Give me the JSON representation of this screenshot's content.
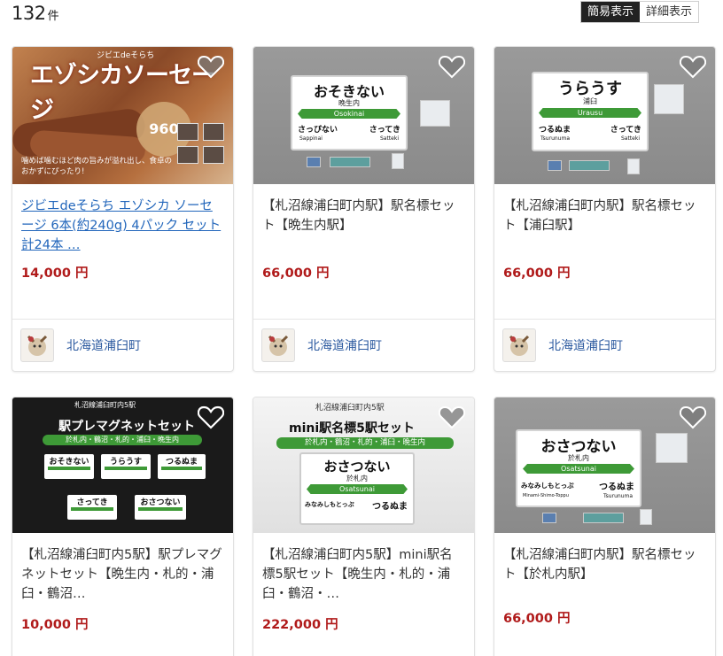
{
  "result": {
    "count": "132",
    "unit": "件"
  },
  "view_toggle": {
    "simple": "簡易表示",
    "detail": "詳細表示"
  },
  "colors": {
    "price": "#b01a1a",
    "link": "#2266bb",
    "seller": "#2c5aa0",
    "board_green": "#3e9a37"
  },
  "products": [
    {
      "title": "ジビエdeそらち エゾシカ ソーセージ 6本(約240g) 4パック セット 計24本 …",
      "price": "14,000 円",
      "seller": "北海道浦臼町",
      "image": {
        "headline": "エゾシカソーセージ",
        "brand": "ジビエdeそらち",
        "badge": "960",
        "caption": "噛めば噛むほど肉の旨みが溢れ出し、食卓のおかずにぴったり!"
      }
    },
    {
      "title": "【札沼線浦臼町内駅】駅名標セット【晩生内駅】",
      "price": "66,000 円",
      "seller": "北海道浦臼町",
      "image": {
        "kana": "おそきない",
        "kanji": "晩生内",
        "romaji": "Osokinai",
        "left": "さっぴない",
        "left_romaji": "Sappinai",
        "right": "さってき",
        "right_romaji": "Satteki"
      }
    },
    {
      "title": "【札沼線浦臼町内駅】駅名標セット【浦臼駅】",
      "price": "66,000 円",
      "seller": "北海道浦臼町",
      "image": {
        "kana": "うらうす",
        "kanji": "浦臼",
        "romaji": "Urausu",
        "left": "つるぬま",
        "left_romaji": "Tsurunuma",
        "right": "さってき",
        "right_romaji": "Satteki"
      }
    },
    {
      "title": "【札沼線浦臼町内5駅】駅プレマグネットセット【晩生内・札的・浦臼・鶴沼…",
      "price": "10,000 円",
      "image": {
        "top": "札沼線浦臼町内5駅",
        "headline": "駅プレマグネットセット",
        "band": "於札内・鶴沼・札的・浦臼・晩生内",
        "boards": [
          "おそきない",
          "うらうす",
          "つるぬま",
          "さってき",
          "おさつない"
        ]
      }
    },
    {
      "title": "【札沼線浦臼町内5駅】mini駅名標5駅セット【晩生内・札的・浦臼・鶴沼・…",
      "price": "222,000 円",
      "image": {
        "top": "札沼線浦臼町内5駅",
        "headline": "mini駅名標5駅セット",
        "band": "於札内・鶴沼・札的・浦臼・晩生内",
        "kana": "おさつない",
        "kanji": "於札内",
        "romaji": "Osatsunai",
        "left": "みなみしもとっぷ",
        "right": "つるぬま"
      }
    },
    {
      "title": "【札沼線浦臼町内駅】駅名標セット【於札内駅】",
      "price": "66,000 円",
      "image": {
        "kana": "おさつない",
        "kanji": "於札内",
        "romaji": "Osatsunai",
        "left": "みなみしもとっぷ",
        "left_romaji": "Minami-Shimo-Toppu",
        "right": "つるぬま",
        "right_romaji": "Tsurunuma"
      }
    }
  ]
}
